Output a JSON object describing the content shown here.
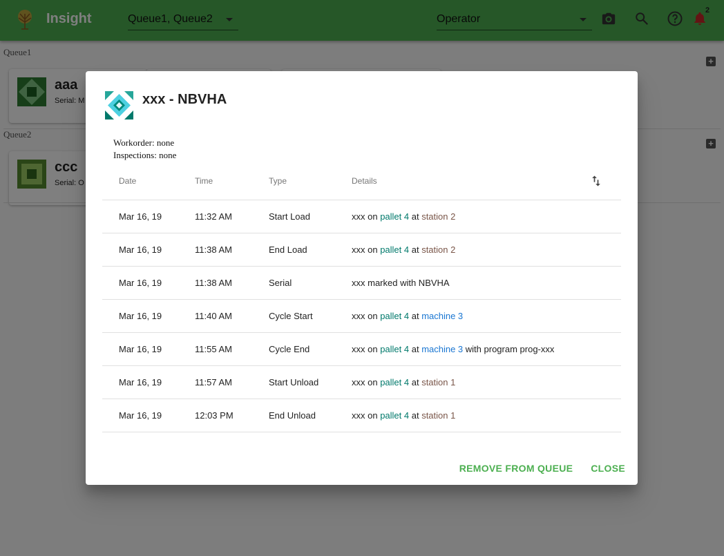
{
  "app": {
    "title": "Insight",
    "queue_select_value": "Queue1, Queue2",
    "operator_select_value": "Operator",
    "notification_count": "2",
    "colors": {
      "appbar": "#4caf50",
      "accent": "#4caf50",
      "notification": "#c62828"
    }
  },
  "page": {
    "queues": [
      {
        "label": "Queue1",
        "card": {
          "name": "aaa",
          "serial": "Serial: M"
        }
      },
      {
        "label": "Queue2",
        "card": {
          "name": "ccc",
          "serial": "Serial: O"
        }
      }
    ]
  },
  "dialog": {
    "title": "xxx - NBVHA",
    "workorder": "Workorder: none",
    "inspections": "Inspections: none",
    "columns": {
      "date": "Date",
      "time": "Time",
      "type": "Type",
      "details": "Details"
    },
    "rows": [
      {
        "date": "Mar 16, 19",
        "time": "11:32 AM",
        "type": "Start Load",
        "d1": "xxx on ",
        "pallet": "pallet 4",
        "d2": " at ",
        "loc": "station 2",
        "loc_kind": "station",
        "d3": ""
      },
      {
        "date": "Mar 16, 19",
        "time": "11:38 AM",
        "type": "End Load",
        "d1": "xxx on ",
        "pallet": "pallet 4",
        "d2": " at ",
        "loc": "station 2",
        "loc_kind": "station",
        "d3": ""
      },
      {
        "date": "Mar 16, 19",
        "time": "11:38 AM",
        "type": "Serial",
        "d1": "xxx marked with NBVHA",
        "pallet": "",
        "d2": "",
        "loc": "",
        "loc_kind": "",
        "d3": ""
      },
      {
        "date": "Mar 16, 19",
        "time": "11:40 AM",
        "type": "Cycle Start",
        "d1": "xxx on ",
        "pallet": "pallet 4",
        "d2": " at ",
        "loc": "machine 3",
        "loc_kind": "machine",
        "d3": ""
      },
      {
        "date": "Mar 16, 19",
        "time": "11:55 AM",
        "type": "Cycle End",
        "d1": "xxx on ",
        "pallet": "pallet 4",
        "d2": " at ",
        "loc": "machine 3",
        "loc_kind": "machine",
        "d3": " with program prog-xxx"
      },
      {
        "date": "Mar 16, 19",
        "time": "11:57 AM",
        "type": "Start Unload",
        "d1": "xxx on ",
        "pallet": "pallet 4",
        "d2": " at ",
        "loc": "station 1",
        "loc_kind": "station",
        "d3": ""
      },
      {
        "date": "Mar 16, 19",
        "time": "12:03 PM",
        "type": "End Unload",
        "d1": "xxx on ",
        "pallet": "pallet 4",
        "d2": " at ",
        "loc": "station 1",
        "loc_kind": "station",
        "d3": ""
      }
    ],
    "actions": {
      "remove": "REMOVE FROM QUEUE",
      "close": "CLOSE"
    }
  }
}
